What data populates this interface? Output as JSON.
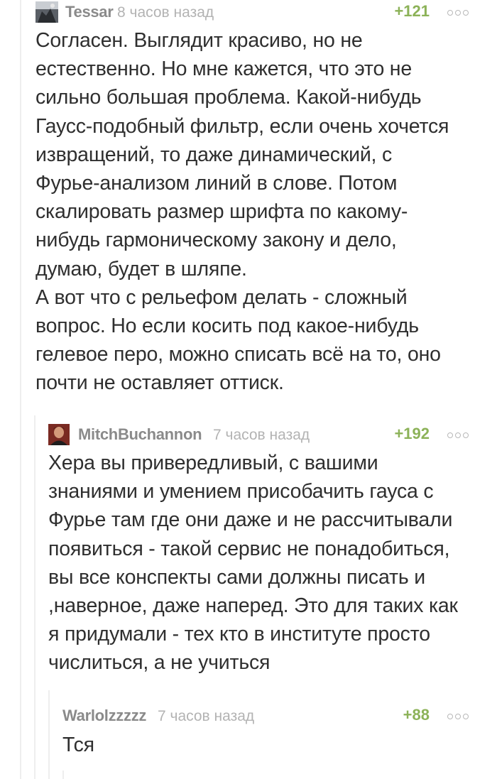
{
  "comments": [
    {
      "username": "Tessar",
      "time": "8 часов назад",
      "rating": "+121",
      "text": "Согласен. Выглядит красиво, но не\nестественно. Но мне кажется, что это не\nсильно большая проблема. Какой-нибудь\nГаусс-подобный фильтр, если очень хочется\nизвращений, то даже динамический, с\nФурье-анализом линий в слове. Потом\nскалировать размер шрифта по какому-\nнибудь гармоническому закону и дело,\nдумаю, будет в шляпе.\nА вот что с рельефом делать - сложный\nвопрос. Но если косить под какое-нибудь\nгелевое перо, можно списать всё на то, оно\nпочти не оставляет оттиск."
    },
    {
      "username": "MitchBuchannon",
      "time": "7 часов назад",
      "rating": "+192",
      "text": "Хера вы привередливый, с вашими\nзнаниями и умением присобачить гауса с\nФурье там где они даже и не рассчитывали\nпоявиться - такой сервис не понадобиться,\nвы все конспекты сами должны писать и\n,наверное, даже наперед. Это для таких как\nя придумали - тех кто в институте просто\nчислиться, а не учиться"
    },
    {
      "username": "Warlolzzzzz",
      "time": "7 часов назад",
      "rating": "+88",
      "text": "Тся"
    }
  ]
}
